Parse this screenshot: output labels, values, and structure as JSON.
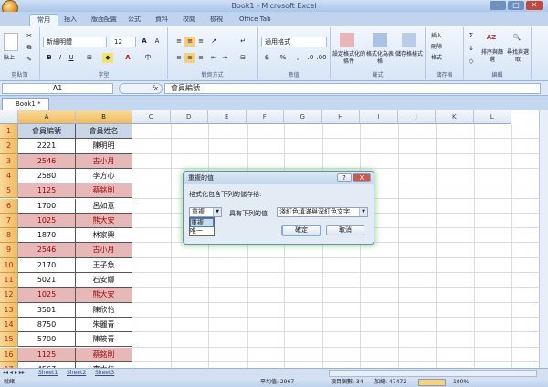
{
  "window": {
    "title": "Book1 - Microsoft Excel"
  },
  "ribbon": {
    "tabs": [
      "常用",
      "插入",
      "版面配置",
      "公式",
      "資料",
      "校閱",
      "檢視",
      "Office Tab"
    ],
    "active_tab": "常用",
    "font_name": "新細明體",
    "font_size": "12",
    "number_format": "通用格式",
    "groups": [
      "剪貼簿",
      "字型",
      "對齊方式",
      "數值",
      "樣式",
      "儲存格",
      "編輯"
    ],
    "paste_label": "貼上",
    "style_buttons": [
      "設定格式化的條件",
      "格式化為表格",
      "儲存格樣式"
    ],
    "cell_buttons": [
      "插入",
      "刪除",
      "格式"
    ],
    "edit_buttons": [
      "排序與篩選",
      "尋找與選取"
    ]
  },
  "formula_bar": {
    "name_box": "A1",
    "fx": "fx",
    "formula": "會員編號"
  },
  "workbook_tab": "Book1 *",
  "columns": [
    "A",
    "B",
    "C",
    "D",
    "E",
    "F",
    "G",
    "H",
    "I",
    "J",
    "K",
    "L"
  ],
  "rows": [
    {
      "n": "1",
      "a": "會員編號",
      "b": "會員姓名",
      "dup": false,
      "hdr": true
    },
    {
      "n": "2",
      "a": "2221",
      "b": "陳明明",
      "dup": false
    },
    {
      "n": "3",
      "a": "2546",
      "b": "古小月",
      "dup": true
    },
    {
      "n": "4",
      "a": "2580",
      "b": "李方心",
      "dup": false
    },
    {
      "n": "5",
      "a": "1125",
      "b": "蔡銘則",
      "dup": true
    },
    {
      "n": "6",
      "a": "1700",
      "b": "呂如意",
      "dup": false
    },
    {
      "n": "7",
      "a": "1025",
      "b": "熊大安",
      "dup": true
    },
    {
      "n": "8",
      "a": "1870",
      "b": "林家興",
      "dup": false
    },
    {
      "n": "9",
      "a": "2546",
      "b": "古小月",
      "dup": true
    },
    {
      "n": "10",
      "a": "2170",
      "b": "王子魚",
      "dup": false
    },
    {
      "n": "11",
      "a": "5021",
      "b": "石安娜",
      "dup": false
    },
    {
      "n": "12",
      "a": "1025",
      "b": "熊大安",
      "dup": true
    },
    {
      "n": "13",
      "a": "3501",
      "b": "陳欣怡",
      "dup": false
    },
    {
      "n": "14",
      "a": "8750",
      "b": "朱麗青",
      "dup": false
    },
    {
      "n": "15",
      "a": "5700",
      "b": "陳筱青",
      "dup": false
    },
    {
      "n": "16",
      "a": "1125",
      "b": "蔡銘則",
      "dup": true
    },
    {
      "n": "17",
      "a": "4567",
      "b": "李大仁",
      "dup": false
    }
  ],
  "sheets": [
    "Sheet1",
    "Sheet2",
    "Sheet3"
  ],
  "status": {
    "mode": "就緒",
    "average": "平均值: 2967",
    "count": "項目個數: 34",
    "sum": "加總: 47472",
    "zoom": "100%"
  },
  "dialog": {
    "title": "重複的值",
    "prompt": "格式化包含下列的儲存格:",
    "type_value": "重複",
    "options": [
      "重複",
      "唯一"
    ],
    "with_label": "具有下列的值",
    "format_value": "淺紅色填滿與深紅色文字",
    "ok": "確定",
    "cancel": "取消",
    "help": "?",
    "close": "X"
  },
  "colors": {
    "duplicate_fill": "#e6b9b8",
    "duplicate_text": "#9c0006",
    "header_fill": "#c9d6e8"
  }
}
